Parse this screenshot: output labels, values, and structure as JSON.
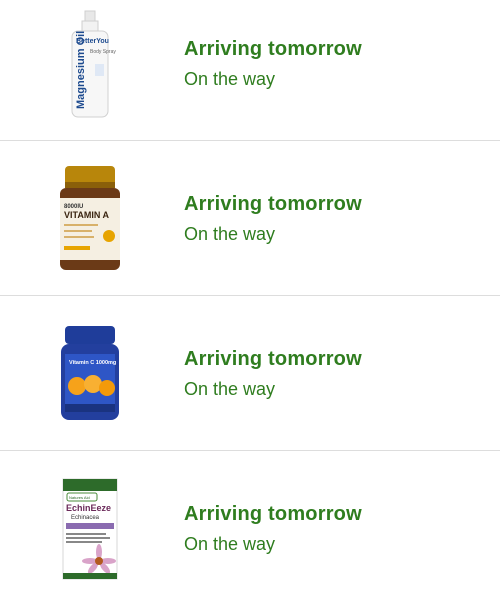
{
  "orders": [
    {
      "product_icon": "magnesium-oil-spray-bottle",
      "status": "Arriving tomorrow",
      "substatus": "On the way",
      "label_brand": "BetterYou",
      "label_name": "Magnesium Oil",
      "label_sub": "Body Spray"
    },
    {
      "product_icon": "vitamin-a-supplement-jar",
      "status": "Arriving tomorrow",
      "substatus": "On the way",
      "label_top": "8000IU",
      "label_name": "VITAMIN A"
    },
    {
      "product_icon": "vitamin-c-supplement-jar",
      "status": "Arriving tomorrow",
      "substatus": "On the way",
      "label_name": "Vitamin C 1000mg"
    },
    {
      "product_icon": "echinacea-supplement-box",
      "status": "Arriving tomorrow",
      "substatus": "On the way",
      "label_brand": "Natures Aid",
      "label_name": "EchinEeze",
      "label_sub": "Echinacea"
    }
  ],
  "colors": {
    "status_green": "#2f7d1f",
    "divider": "#dddddd"
  }
}
